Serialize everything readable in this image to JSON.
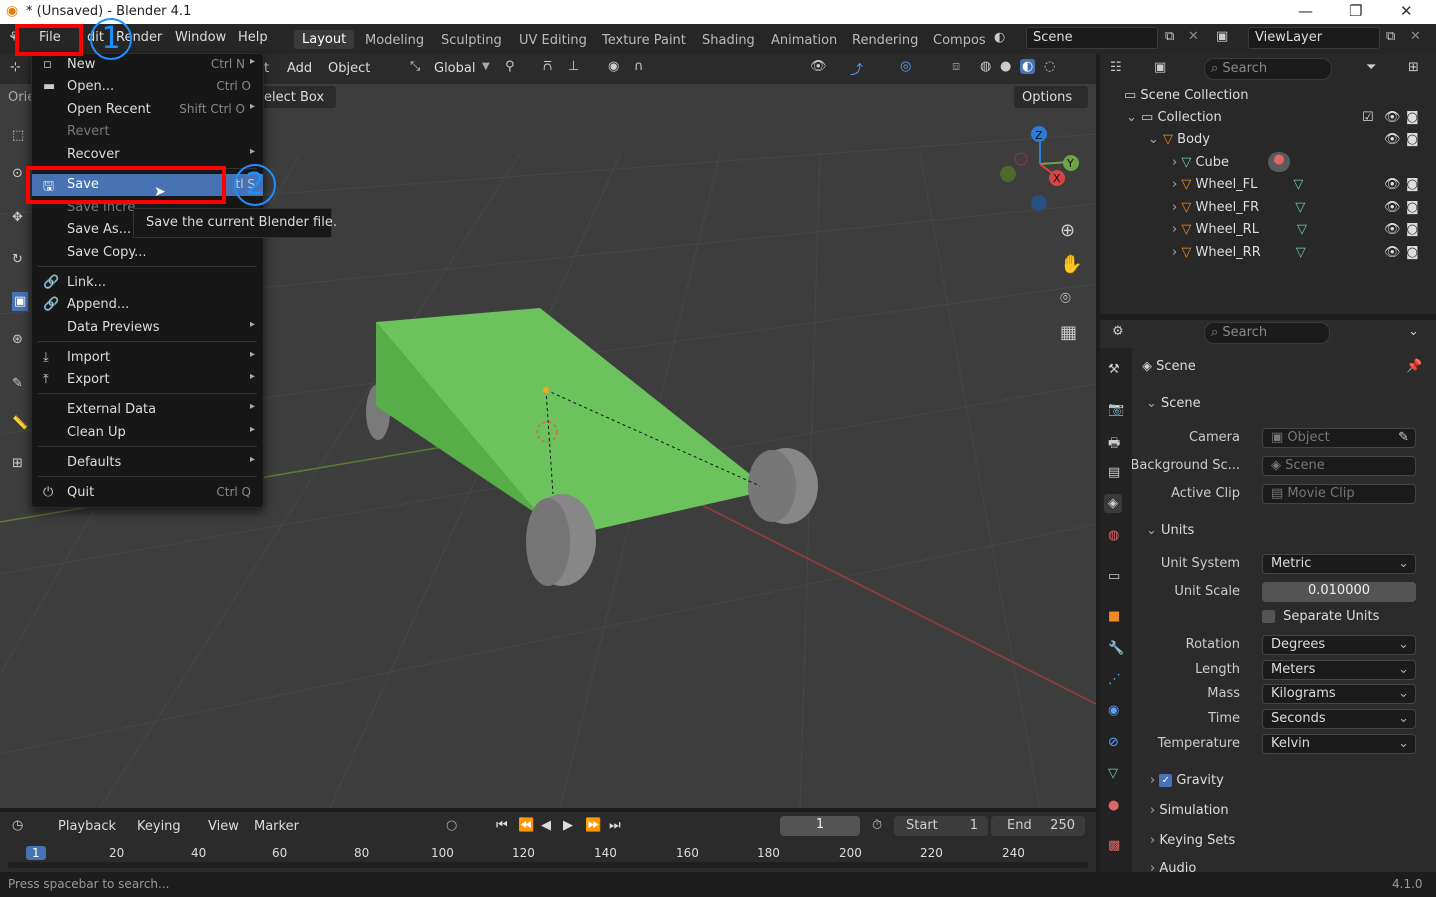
{
  "window": {
    "title": "* (Unsaved) - Blender 4.1"
  },
  "menubar": {
    "file": "File",
    "edit_partial": "dit",
    "render": "Render",
    "window": "Window",
    "help": "Help"
  },
  "workspaces": [
    "Layout",
    "Modeling",
    "Sculpting",
    "UV Editing",
    "Texture Paint",
    "Shading",
    "Animation",
    "Rendering",
    "Compos"
  ],
  "scene_selector": {
    "value": "Scene"
  },
  "viewlayer_selector": {
    "value": "ViewLayer"
  },
  "viewport_header": {
    "partial_left": "Orie",
    "view_partial": "t",
    "add": "Add",
    "object": "Object",
    "transform": "Global",
    "select_box": "elect Box",
    "options": "Options"
  },
  "file_menu": {
    "new": "New",
    "new_sc": "Ctrl N",
    "open": "Open...",
    "open_sc": "Ctrl O",
    "open_recent": "Open Recent",
    "open_recent_sc": "Shift Ctrl O",
    "revert": "Revert",
    "recover": "Recover",
    "save": "Save",
    "save_sc_partial": "tl S",
    "save_incremental_partial": "Save Incre",
    "save_as": "Save As...",
    "save_copy": "Save Copy...",
    "link": "Link...",
    "append": "Append...",
    "data_previews": "Data Previews",
    "import": "Import",
    "export": "Export",
    "external_data": "External Data",
    "clean_up": "Clean Up",
    "defaults": "Defaults",
    "quit": "Quit",
    "quit_sc": "Ctrl Q"
  },
  "tooltip": "Save the current Blender file.",
  "annotations": {
    "step1": "1",
    "step2": "2"
  },
  "outliner": {
    "search_placeholder": "Search",
    "scene_collection": "Scene Collection",
    "collection": "Collection",
    "body": "Body",
    "items": [
      "Cube",
      "Wheel_FL",
      "Wheel_FR",
      "Wheel_RL",
      "Wheel_RR"
    ]
  },
  "properties": {
    "search_placeholder": "Search",
    "context": "Scene",
    "scene_panel": "Scene",
    "camera_label": "Camera",
    "camera_value": "Object",
    "background_label": "Background Sc...",
    "background_value": "Scene",
    "active_clip_label": "Active Clip",
    "active_clip_value": "Movie Clip",
    "units_panel": "Units",
    "unit_system_label": "Unit System",
    "unit_system_value": "Metric",
    "unit_scale_label": "Unit Scale",
    "unit_scale_value": "0.010000",
    "separate_units": "Separate Units",
    "rotation_label": "Rotation",
    "rotation_value": "Degrees",
    "length_label": "Length",
    "length_value": "Meters",
    "mass_label": "Mass",
    "mass_value": "Kilograms",
    "time_label": "Time",
    "time_value": "Seconds",
    "temperature_label": "Temperature",
    "temperature_value": "Kelvin",
    "gravity": "Gravity",
    "simulation": "Simulation",
    "keying_sets": "Keying Sets",
    "audio": "Audio"
  },
  "timeline": {
    "playback": "Playback",
    "keying": "Keying",
    "view": "View",
    "marker": "Marker",
    "current_frame": "1",
    "start_label": "Start",
    "start_value": "1",
    "end_label": "End",
    "end_value": "250",
    "ruler": [
      "1",
      "20",
      "40",
      "60",
      "80",
      "100",
      "120",
      "140",
      "160",
      "180",
      "200",
      "220",
      "240"
    ]
  },
  "statusbar": {
    "hint": "Press spacebar to search...",
    "version": "4.1.0"
  }
}
